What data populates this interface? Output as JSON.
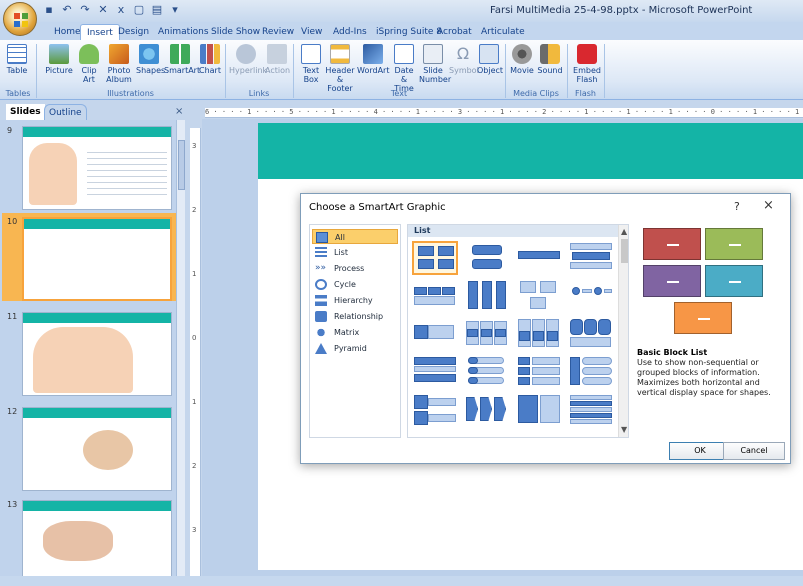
{
  "window": {
    "title": "Farsi MultiMedia 25-4-98.pptx - Microsoft PowerPoint"
  },
  "ribbon_tabs": [
    "Home",
    "Insert",
    "Design",
    "Animations",
    "Slide Show",
    "Review",
    "View",
    "Add-Ins",
    "iSpring Suite 8",
    "Acrobat",
    "Articulate"
  ],
  "active_tab": "Insert",
  "ribbon": {
    "buttons": {
      "table": "Table",
      "picture": "Picture",
      "clip_art": "Clip Art",
      "photo_album": "Photo Album",
      "shapes": "Shapes",
      "smartart": "SmartArt",
      "chart": "Chart",
      "hyperlink": "Hyperlink",
      "action": "Action",
      "text_box": "Text Box",
      "header_footer": "Header & Footer",
      "wordart": "WordArt",
      "date_time": "Date & Time",
      "slide_number": "Slide Number",
      "symbol": "Symbol",
      "object": "Object",
      "movie": "Movie",
      "sound": "Sound",
      "embed_flash": "Embed Flash"
    },
    "groups": {
      "tables": "Tables",
      "illustrations": "Illustrations",
      "links": "Links",
      "text": "Text",
      "media_clips": "Media Clips",
      "flash": "Flash"
    }
  },
  "slides_pane": {
    "tabs": [
      "Slides",
      "Outline"
    ],
    "close_glyph": "×",
    "slide_numbers": [
      "9",
      "10",
      "11",
      "12",
      "13"
    ]
  },
  "ruler": {
    "horizontal": "6 · · · · 1 · · · · 5 · · · · 1 · · · · 4 · · · · 1 · · · · 3 · · · · 1 · · · · 2 · · · · 1 · · · · 1 · · · · 1 · · · · 0 · · · · 1 · · · · 1 · · · · 1 · · · · 2 · · · ·",
    "vertical": [
      "3",
      "2",
      "1",
      "0",
      "1",
      "2",
      "3"
    ]
  },
  "dialog": {
    "title": "Choose a SmartArt Graphic",
    "help_glyph": "?",
    "close_glyph": "×",
    "categories": [
      "All",
      "List",
      "Process",
      "Cycle",
      "Hierarchy",
      "Relationship",
      "Matrix",
      "Pyramid"
    ],
    "selected_category": "All",
    "gallery_header": "List",
    "preview": {
      "title": "Basic Block List",
      "description": "Use to show non-sequential or grouped blocks of information. Maximizes both horizontal and vertical display space for shapes.",
      "block_colors": [
        "#c0504d",
        "#9bbb59",
        "#8064a2",
        "#4bacc6",
        "#f79646"
      ]
    },
    "buttons": {
      "ok": "OK",
      "cancel": "Cancel"
    }
  },
  "colors": {
    "slide_accent": "#14b4a6",
    "selection": "#f7a33c"
  }
}
